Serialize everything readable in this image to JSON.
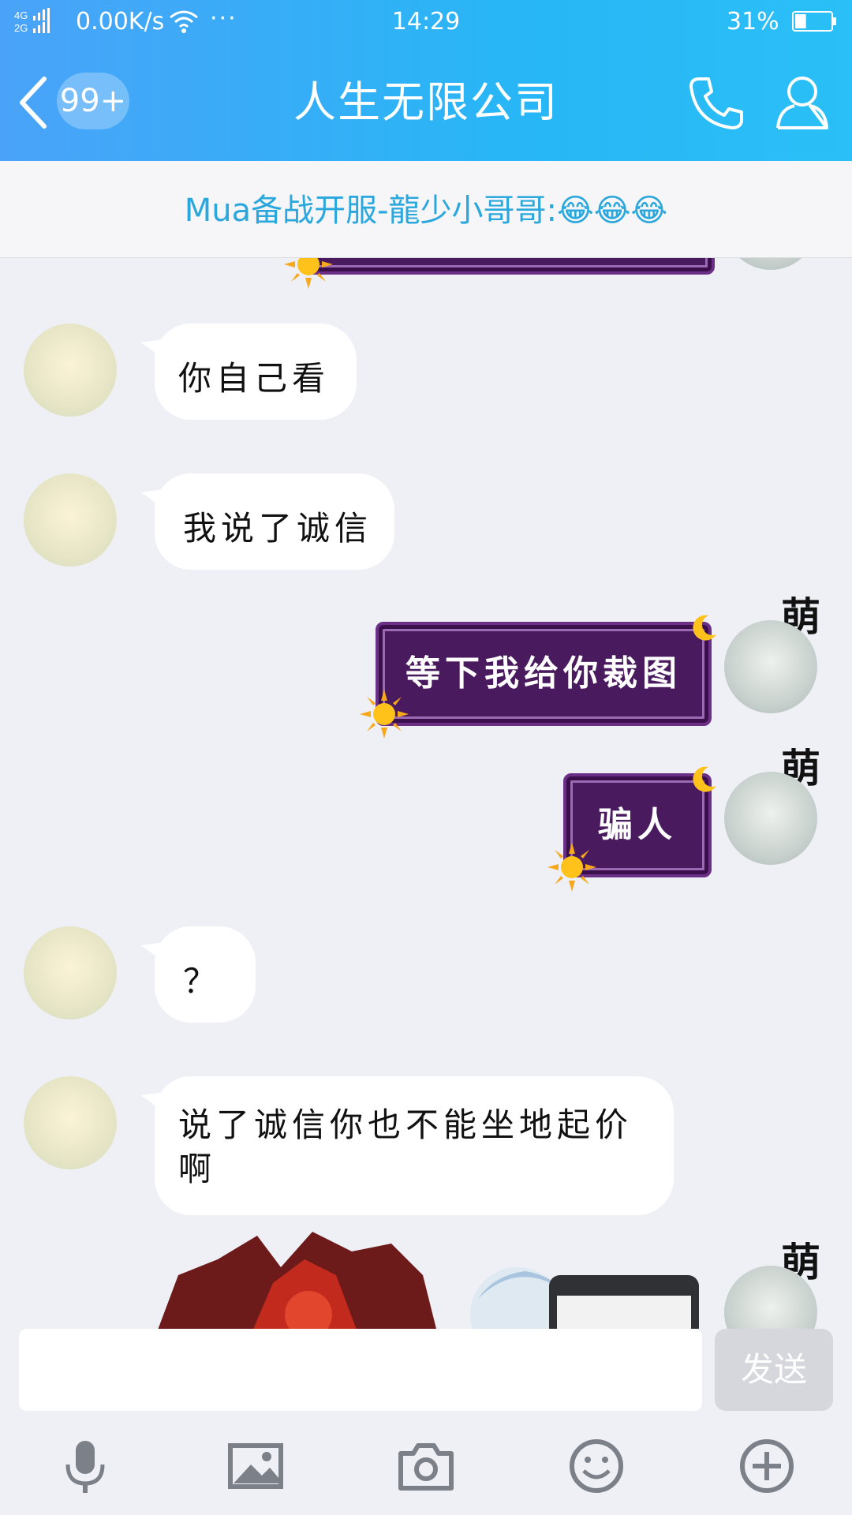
{
  "status_bar": {
    "network": "4G 2G",
    "speed": "0.00K/s",
    "more": "···",
    "time": "14:29",
    "battery": "31%",
    "battery_level": 0.31
  },
  "header": {
    "back_badge": "99+",
    "title": "人生无限公司"
  },
  "pinned_message": {
    "text": "Mua备战开服-龍少小哥哥:😂😂😂"
  },
  "messages": [
    {
      "side": "left",
      "text": "你自己看"
    },
    {
      "side": "left",
      "text": "我说了诚信"
    },
    {
      "side": "right",
      "sender_label": "萌",
      "text": "等下我给你裁图"
    },
    {
      "side": "right",
      "sender_label": "萌",
      "text": "骗人"
    },
    {
      "side": "left",
      "text": "？"
    },
    {
      "side": "left",
      "text": "说了诚信你也不能坐地起价啊"
    },
    {
      "side": "right",
      "sender_label": "萌",
      "type": "image"
    }
  ],
  "input": {
    "placeholder": "",
    "send_label": "发送"
  },
  "toolbar": [
    "microphone-icon",
    "image-icon",
    "camera-icon",
    "emoji-icon",
    "plus-icon"
  ],
  "colors": {
    "header_start": "#4aa3f8",
    "header_end": "#2abff7",
    "pinned_text": "#2aa7dc",
    "bubble_right": "#4a1a5e"
  }
}
